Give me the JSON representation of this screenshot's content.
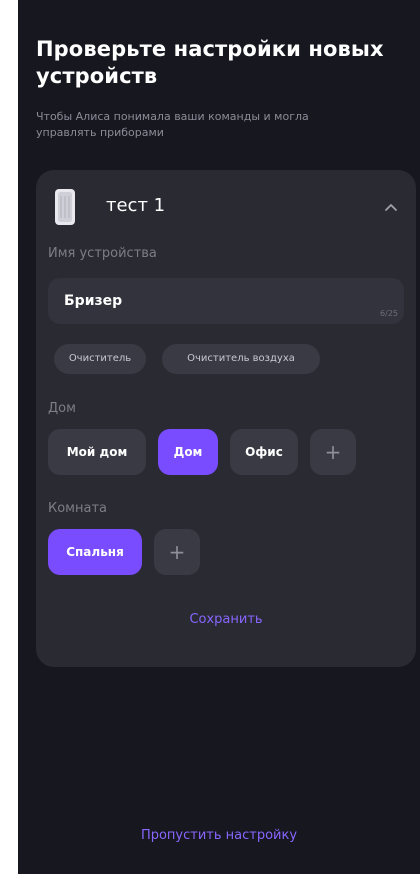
{
  "header": {
    "title": "Проверьте настройки новых устройств",
    "subtitle": "Чтобы Алиса понимала ваши команды и могла управлять приборами"
  },
  "device_card": {
    "device_name": "тест 1",
    "device_icon": "air-purifier-icon",
    "collapse_icon": "chevron-up-icon",
    "name_label": "Имя устройства",
    "name_value": "Бризер",
    "name_counter": "6/25",
    "suggestions": [
      "Очиститель",
      "Очиститель воздуха"
    ],
    "house_label": "Дом",
    "houses": [
      "Мой дом",
      "Дом",
      "Офис"
    ],
    "selected_house": "Дом",
    "room_label": "Комната",
    "rooms": [
      "Спальня"
    ],
    "selected_room": "Спальня",
    "add_symbol": "+",
    "save_label": "Сохранить"
  },
  "footer": {
    "skip_label": "Пропустить настройку"
  },
  "colors": {
    "background": "#17171f",
    "card": "#2a2a33",
    "accent": "#7a4cff",
    "link": "#8866ff"
  }
}
